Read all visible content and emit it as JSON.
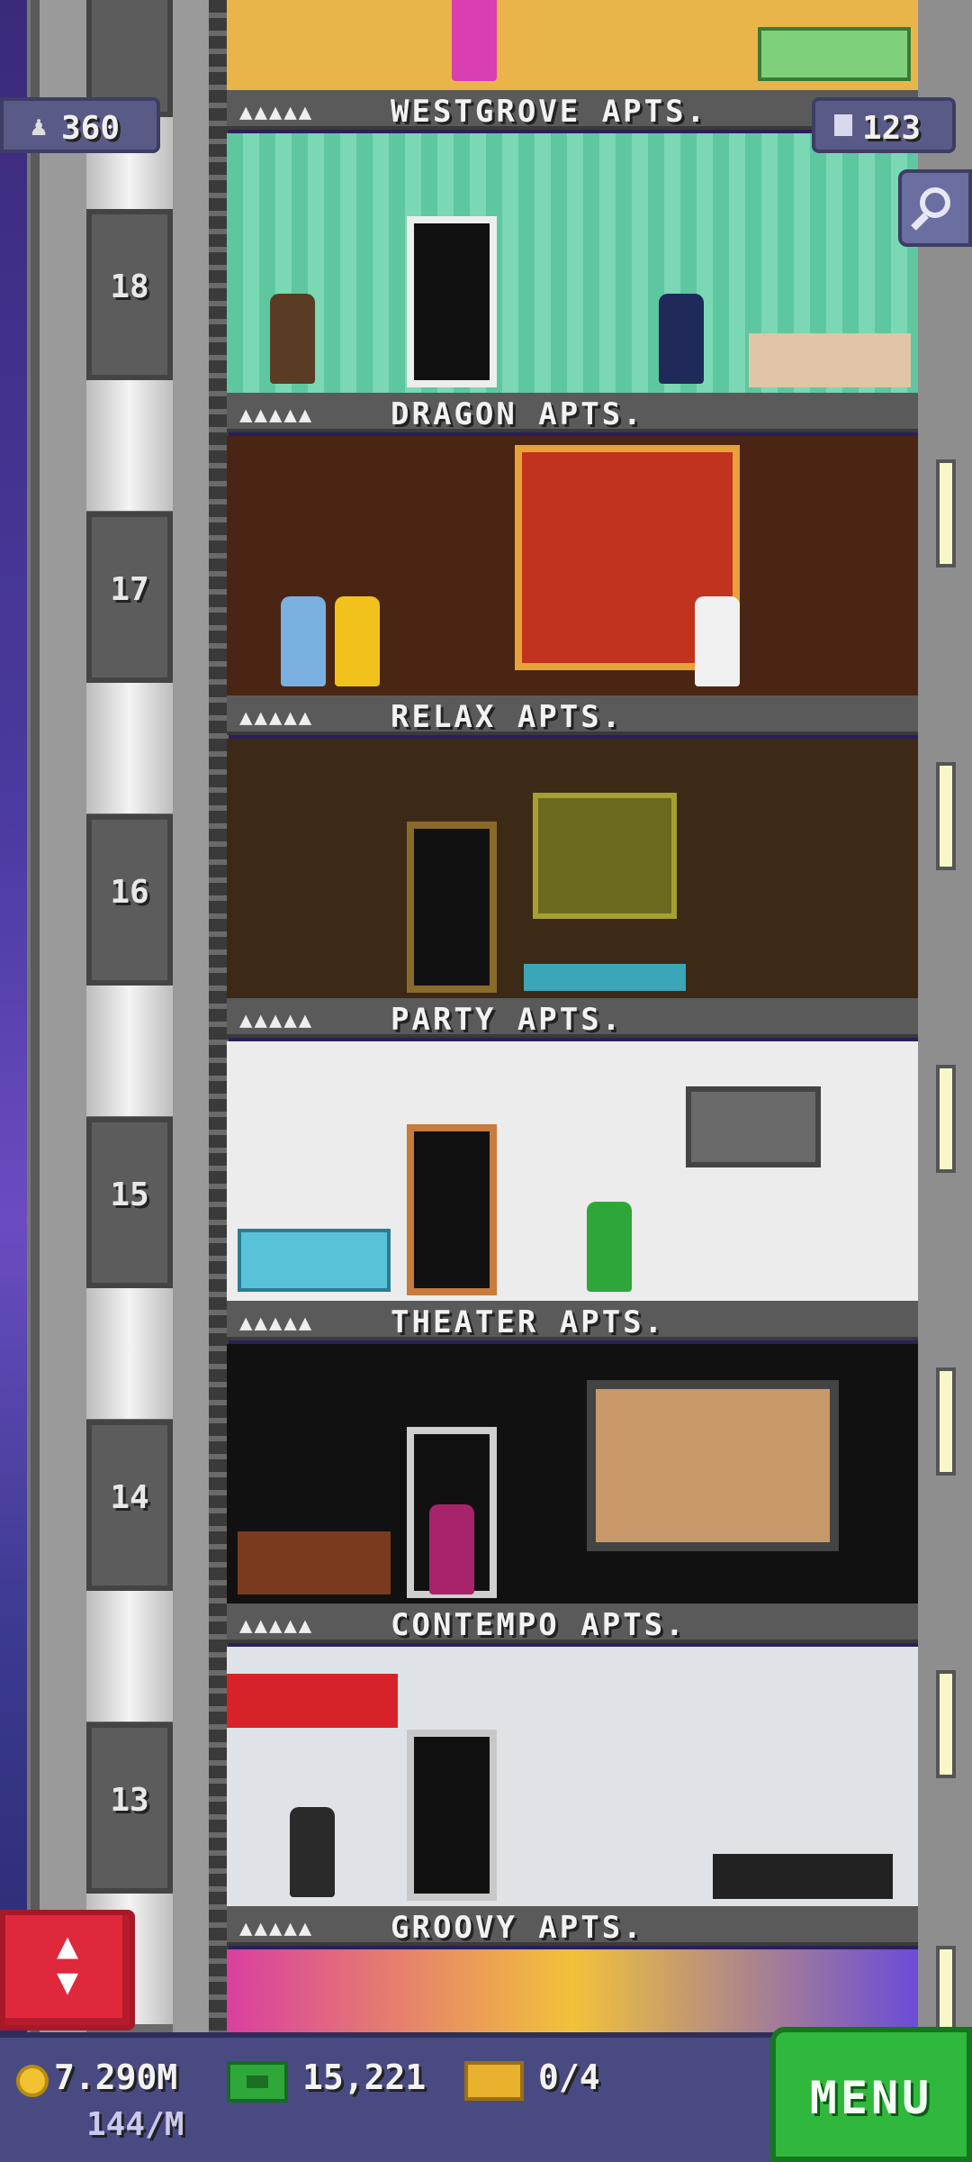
{
  "hud": {
    "population": "360",
    "floors": "123",
    "search_icon": "magnifier-icon"
  },
  "floors": [
    {
      "number": "18",
      "name": "WESTGROVE APTS.",
      "theme": "westgrove",
      "wall": "#5fc7a0"
    },
    {
      "number": "17",
      "name": "DRAGON APTS.",
      "theme": "dragon",
      "wall": "#7a1a12"
    },
    {
      "number": "16",
      "name": "RELAX APTS.",
      "theme": "relax",
      "wall": "#3c2a16"
    },
    {
      "number": "15",
      "name": "PARTY APTS.",
      "theme": "party",
      "wall": "#e6e6e6"
    },
    {
      "number": "14",
      "name": "THEATER APTS.",
      "theme": "theater",
      "wall": "#111111"
    },
    {
      "number": "13",
      "name": "CONTEMPO APTS.",
      "theme": "contempo",
      "wall": "#dfe3e8"
    },
    {
      "number": "",
      "name": "GROOVY APTS.",
      "theme": "groovy",
      "wall": "#d93fa0"
    }
  ],
  "tenant_dots": "▲▲▲▲▲",
  "bottom_bar": {
    "coins": "7.290M",
    "rate": "144/M",
    "bux": "15,221",
    "tickets": "0/4",
    "menu_label": "MENU"
  },
  "colors": {
    "menu_green": "#2fb83c",
    "elevator_red": "#e0283c",
    "hud_purple": "#4a4a82"
  }
}
